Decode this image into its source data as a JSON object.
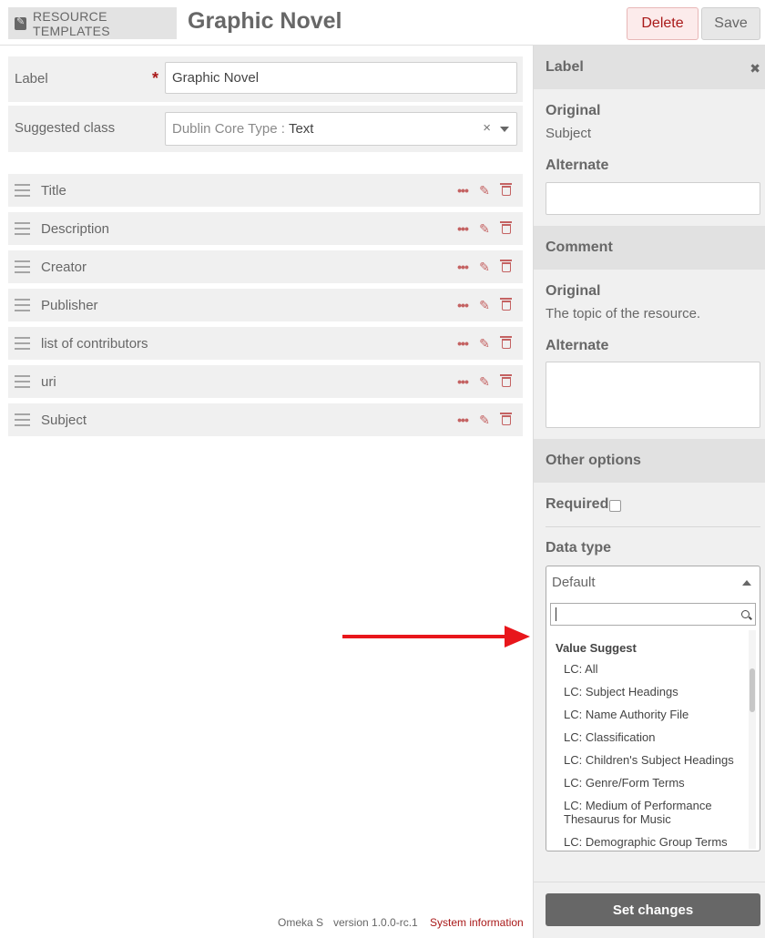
{
  "header": {
    "section_label": "RESOURCE TEMPLATES",
    "title": "Graphic Novel",
    "delete_label": "Delete",
    "save_label": "Save"
  },
  "form": {
    "label_field": {
      "label": "Label",
      "required_marker": "*",
      "value": "Graphic Novel"
    },
    "class_field": {
      "label": "Suggested class",
      "placeholder": "Dublin Core Type :",
      "value": "Text",
      "clear_glyph": "×"
    }
  },
  "properties": [
    {
      "label": "Title"
    },
    {
      "label": "Description"
    },
    {
      "label": "Creator"
    },
    {
      "label": "Publisher"
    },
    {
      "label": "list of contributors"
    },
    {
      "label": "uri"
    },
    {
      "label": "Subject"
    }
  ],
  "row_actions": {
    "more_glyph": "•••",
    "edit_glyph": "✎"
  },
  "footer": {
    "brand": "Omeka S",
    "version": "version 1.0.0-rc.1",
    "system_info": "System information"
  },
  "sidebar": {
    "label_section": {
      "heading": "Label",
      "close_glyph": "✖",
      "original_heading": "Original",
      "original_value": "Subject",
      "alternate_heading": "Alternate",
      "alternate_value": ""
    },
    "comment_section": {
      "heading": "Comment",
      "original_heading": "Original",
      "original_value": "The topic of the resource.",
      "alternate_heading": "Alternate",
      "alternate_value": ""
    },
    "options_section": {
      "heading": "Other options",
      "required_label": "Required",
      "required_checked": false,
      "data_type_label": "Data type"
    },
    "data_type_select": {
      "selected": "Default",
      "search_value": "",
      "group_label": "Value Suggest",
      "options": [
        "LC: All",
        "LC: Subject Headings",
        "LC: Name Authority File",
        "LC: Classification",
        "LC: Children's Subject Headings",
        "LC: Genre/Form Terms",
        "LC: Medium of Performance Thesaurus for Music",
        "LC: Demographic Group Terms"
      ]
    },
    "set_changes_label": "Set changes"
  },
  "colors": {
    "accent_red": "#a91919",
    "action_red": "#c46262",
    "arrow_red": "#e8161b",
    "text_gray": "#676767",
    "panel_gray": "#f0f0f0"
  }
}
